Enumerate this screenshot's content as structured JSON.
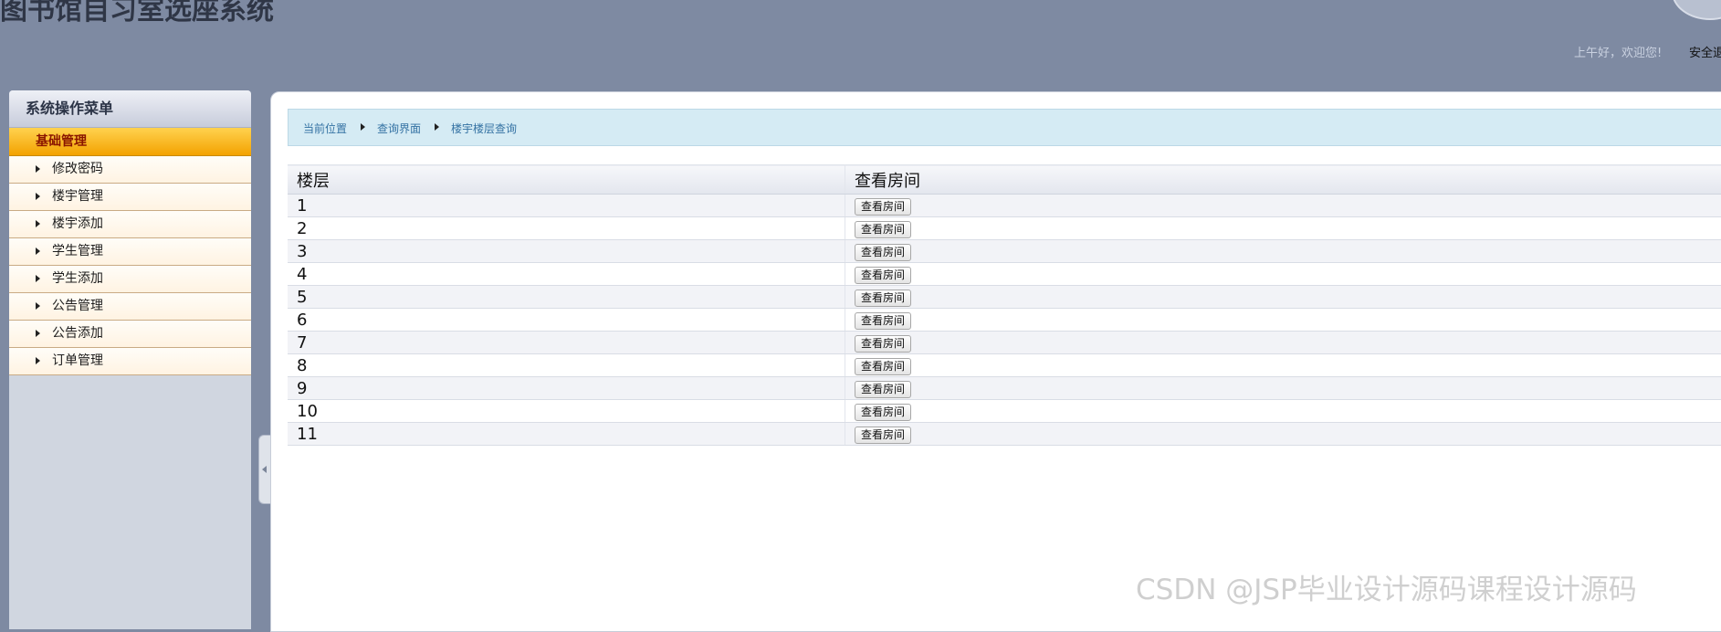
{
  "header": {
    "app_title": "图书馆自习室选座系统",
    "greeting": "上午好，欢迎您!",
    "safe_exit": "安全退"
  },
  "sidebar": {
    "title": "系统操作菜单",
    "section": "基础管理",
    "items": [
      {
        "label": "修改密码"
      },
      {
        "label": "楼宇管理"
      },
      {
        "label": "楼宇添加"
      },
      {
        "label": "学生管理"
      },
      {
        "label": "学生添加"
      },
      {
        "label": "公告管理"
      },
      {
        "label": "公告添加"
      },
      {
        "label": "订单管理"
      }
    ]
  },
  "breadcrumb": {
    "items": [
      "当前位置",
      "查询界面",
      "楼宇楼层查询"
    ]
  },
  "table": {
    "headers": [
      "楼层",
      "查看房间"
    ],
    "button_label": "查看房间",
    "rows": [
      "1",
      "2",
      "3",
      "4",
      "5",
      "6",
      "7",
      "8",
      "9",
      "10",
      "11"
    ]
  },
  "watermark": "CSDN @JSP毕业设计源码课程设计源码"
}
